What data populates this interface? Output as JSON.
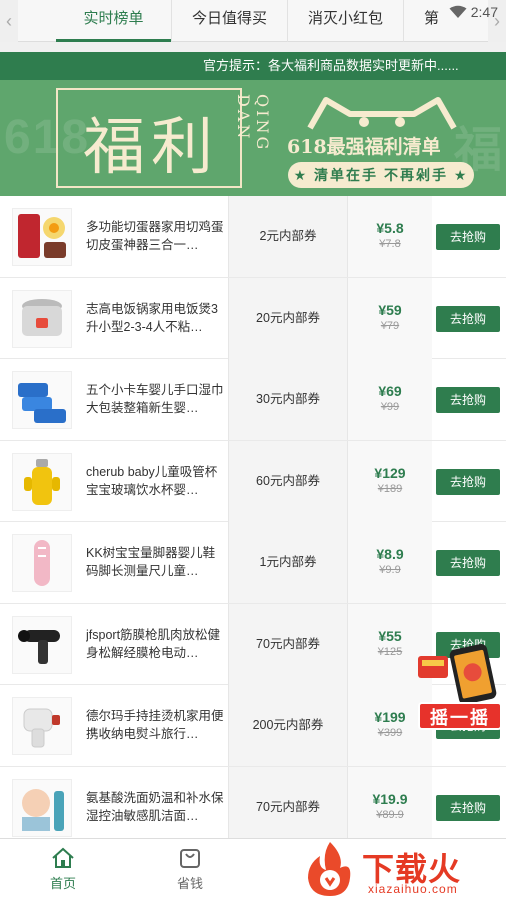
{
  "tabs": [
    "实时榜单",
    "今日值得买",
    "消灭小红包",
    "第"
  ],
  "status": {
    "time": "2:47"
  },
  "notice": "官方提示：各大福利商品数据实时更新中......",
  "banner": {
    "big": "福利",
    "vertical": "QING DAN",
    "promo_title": "618最强福利清单",
    "promo_pill": "★ 清单在手 不再剁手 ★",
    "bg_left": "618",
    "bg_right": "福"
  },
  "products": [
    {
      "title": "多功能切蛋器家用切鸡蛋切皮蛋神器三合一…",
      "coupon": "2元内部券",
      "price": "¥5.8",
      "old": "¥7.8",
      "buy": "去抢购"
    },
    {
      "title": "志高电饭锅家用电饭煲3升小型2-3-4人不粘…",
      "coupon": "20元内部券",
      "price": "¥59",
      "old": "¥79",
      "buy": "去抢购"
    },
    {
      "title": "五个小卡车婴儿手口湿巾大包装整箱新生婴…",
      "coupon": "30元内部券",
      "price": "¥69",
      "old": "¥99",
      "buy": "去抢购"
    },
    {
      "title": "cherub baby儿童吸管杯宝宝玻璃饮水杯婴…",
      "coupon": "60元内部券",
      "price": "¥129",
      "old": "¥189",
      "buy": "去抢购"
    },
    {
      "title": "KK树宝宝量脚器婴儿鞋码脚长测量尺儿童…",
      "coupon": "1元内部券",
      "price": "¥8.9",
      "old": "¥9.9",
      "buy": "去抢购"
    },
    {
      "title": "jfsport筋膜枪肌肉放松健身松解经膜枪电动…",
      "coupon": "70元内部券",
      "price": "¥55",
      "old": "¥125",
      "buy": "去抢购"
    },
    {
      "title": "德尔玛手持挂烫机家用便携收纳电熨斗旅行…",
      "coupon": "200元内部券",
      "price": "¥199",
      "old": "¥399",
      "buy": "去抢购"
    },
    {
      "title": "氨基酸洗面奶温和补水保湿控油敏感肌洁面…",
      "coupon": "70元内部券",
      "price": "¥19.9",
      "old": "¥89.9",
      "buy": "去抢购"
    }
  ],
  "shake": "摇一摇",
  "nav": {
    "home": "首页",
    "save": "省钱"
  },
  "watermark": {
    "main": "下载火",
    "sub": "xiazaihuo.com"
  },
  "colors": {
    "accent": "#2f7d4e",
    "banner": "#5fa66d",
    "price": "#2e7d4f"
  }
}
